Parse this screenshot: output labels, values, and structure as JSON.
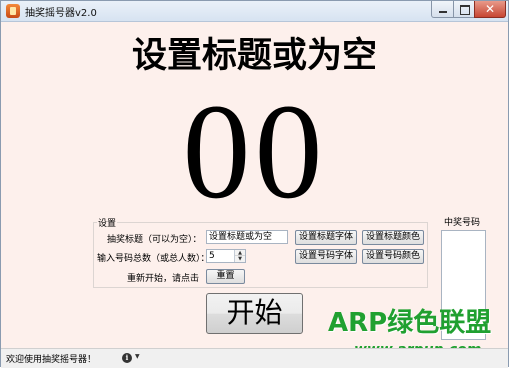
{
  "window": {
    "title": "抽奖摇号器v2.0",
    "close_glyph": "✕"
  },
  "display": {
    "title": "设置标题或为空",
    "number": "00"
  },
  "settings": {
    "legend": "设置",
    "title_label": "抽奖标题（可以为空）：",
    "title_value": "设置标题或为空",
    "count_label": "输入号码总数（或总人数）：",
    "count_value": "5",
    "restart_label": "重新开始，请点击",
    "buttons": {
      "title_font": "设置标题字体",
      "title_color": "设置标题颜色",
      "number_font": "设置号码字体",
      "number_color": "设置号码颜色",
      "reset": "重置"
    },
    "spin_up": "▲",
    "spin_down": "▼"
  },
  "start_button": "开始",
  "winners": {
    "label": "中奖号码",
    "items": []
  },
  "status": {
    "text": "欢迎使用抽奖摇号器！",
    "info_icon": "info-icon",
    "info_glyph": "i",
    "caret": "▼"
  },
  "watermark": {
    "main": "ARP绿色联盟",
    "url": "www.arpun.com",
    "color": "#20a030"
  },
  "colors": {
    "background": "#fdf0ec",
    "titlebar": "#d7e3f1"
  }
}
